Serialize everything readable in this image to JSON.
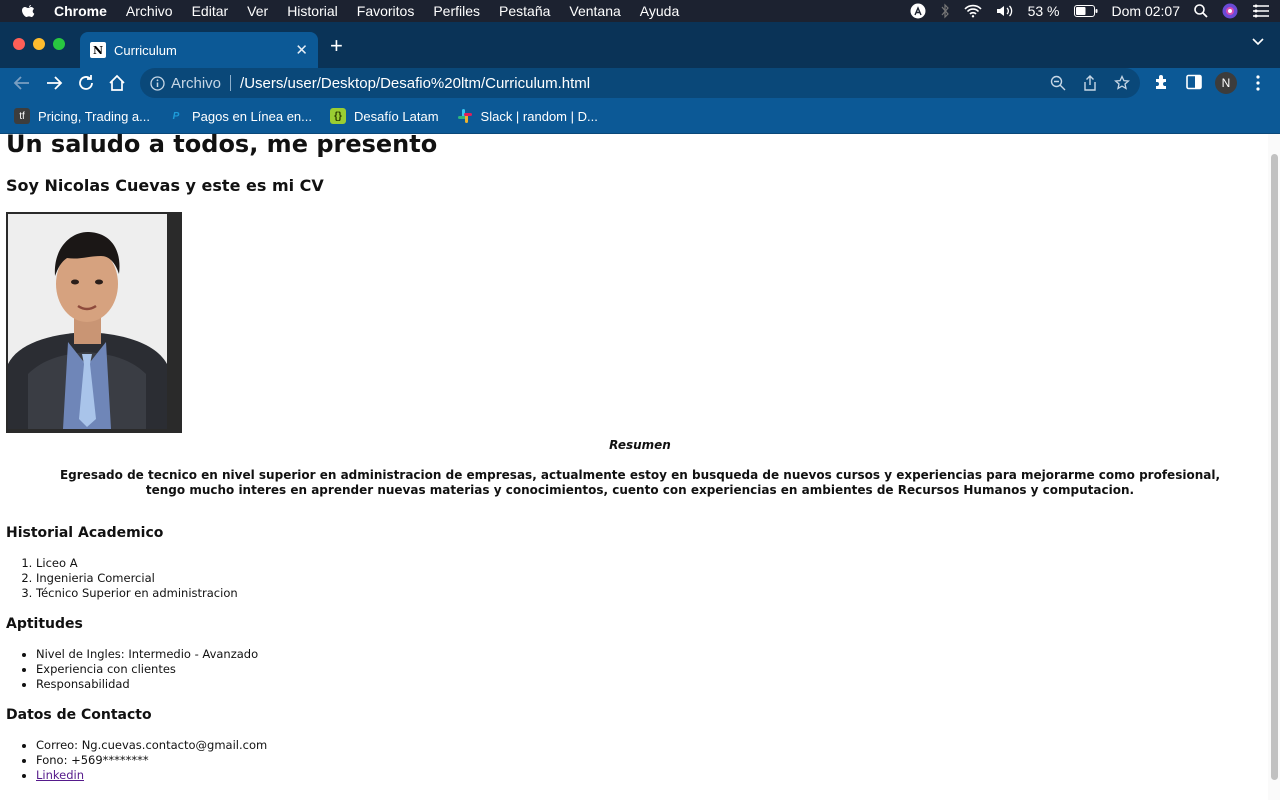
{
  "menubar": {
    "app_name": "Chrome",
    "items": [
      "Archivo",
      "Editar",
      "Ver",
      "Historial",
      "Favoritos",
      "Perfiles",
      "Pestaña",
      "Ventana",
      "Ayuda"
    ],
    "battery": "53 %",
    "clock": "Dom 02:07"
  },
  "browser": {
    "tab_title": "Curriculum",
    "favicon_letter": "N",
    "address_scheme": "Archivo",
    "address_path": "/Users/user/Desktop/Desafio%20ltm/Curriculum.html",
    "profile_initial": "N",
    "accent_color": "#0c5996"
  },
  "bookmarks": [
    {
      "label": "Pricing, Trading a...",
      "icon": "tf-icon",
      "icon_text": "tf"
    },
    {
      "label": "Pagos en Línea en...",
      "icon": "paypal-icon",
      "icon_text": "P"
    },
    {
      "label": "Desafío Latam",
      "icon": "desafio-icon",
      "icon_text": "{}"
    },
    {
      "label": "Slack | random | D...",
      "icon": "slack-icon",
      "icon_text": "#"
    }
  ],
  "page": {
    "h1": "Un saludo a todos, me presento",
    "subtitle": "Soy Nicolas Cuevas y este es mi CV",
    "resumen_title": "Resumen",
    "resumen_text": "Egresado de tecnico en nivel superior en administracion de empresas, actualmente estoy en busqueda de nuevos cursos y experiencias para mejorarme como profesional, tengo mucho interes en aprender nuevas materias y conocimientos, cuento con experiencias en ambientes de Recursos Humanos y computacion.",
    "academic_title": "Historial Academico",
    "academic_items": [
      "Liceo A",
      "Ingenieria Comercial",
      "Técnico Superior en administracion"
    ],
    "skills_title": "Aptitudes",
    "skills_items": [
      "Nivel de Ingles: Intermedio - Avanzado",
      "Experiencia con clientes",
      "Responsabilidad"
    ],
    "contact_title": "Datos de Contacto",
    "contact_items": [
      "Correo: Ng.cuevas.contacto@gmail.com",
      "Fono: +569********"
    ],
    "contact_link": "Linkedin"
  }
}
